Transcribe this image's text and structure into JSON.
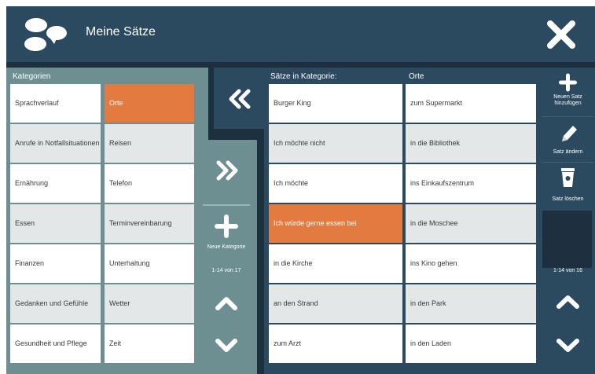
{
  "header": {
    "title": "Meine Sätze",
    "logo_icon": "speech-bubbles-icon",
    "close_icon": "close-icon"
  },
  "categories": {
    "label": "Kategorien",
    "col1": [
      "Sprachverlauf",
      "Anrufe in Notfallsituationen",
      "Ernährung",
      "Essen",
      "Finanzen",
      "Gedanken und Gefühle",
      "Gesundheit und Pflege"
    ],
    "col2": [
      "Orte",
      "Reisen",
      "Telefon",
      "Terminvereinbarung",
      "Unterhaltung",
      "Wetter",
      "Zeit"
    ],
    "selected": "Orte",
    "new_category_label": "Neue Kategorie",
    "counter": "1-14 von 17"
  },
  "sentences": {
    "label": "Sätze in Kategorie:",
    "col1": [
      "Burger King",
      "Ich möchte nicht",
      "Ich möchte",
      "Ich würde gerne essen bei",
      "in die Kirche",
      "an den Strand",
      "zum Arzt"
    ],
    "col2_label": "Orte",
    "col2": [
      "zum Supermarkt",
      "in die Bibliothek",
      "ins Einkaufszentrum",
      "in die Moschee",
      "ins Kino gehen",
      "in den Park",
      "in den Laden"
    ],
    "selected": "Ich würde gerne essen bei",
    "counter": "1-14 von 16"
  },
  "tools": {
    "add_label": "Neuen Satz hinzufügen",
    "edit_label": "Satz ändern",
    "delete_label": "Satz löschen"
  },
  "colors": {
    "accent": "#e37a3f",
    "header": "#2b4a5f",
    "panel": "#6e8f92",
    "background": "#1e3040"
  }
}
